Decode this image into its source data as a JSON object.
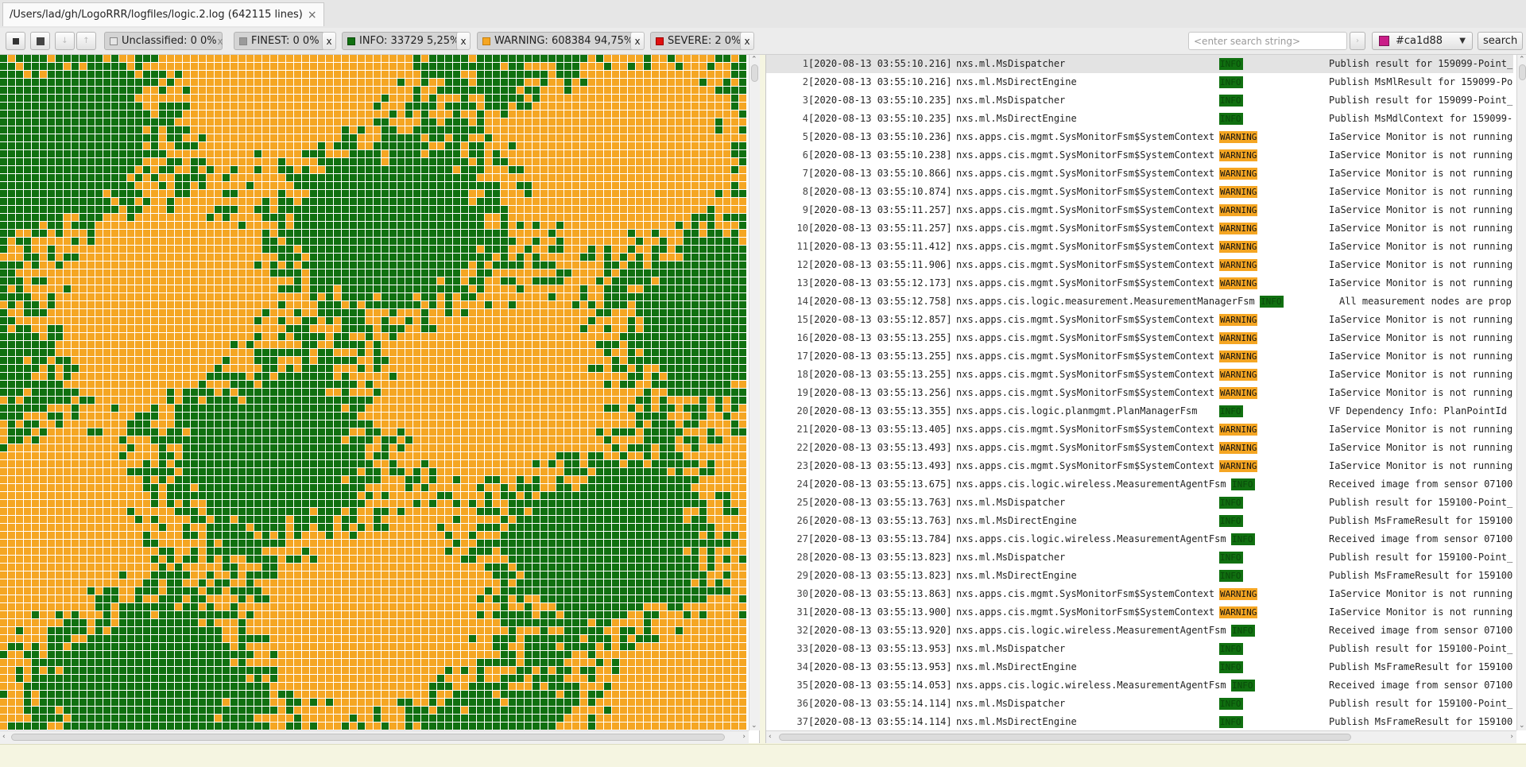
{
  "tab": {
    "title": "/Users/lad/gh/LogoRRR/logfiles/logic.2.log (642115 lines)",
    "close": "×"
  },
  "toolbar": {
    "filters": [
      {
        "label": "Unclassified: 0 0%",
        "color": "#e6e6e6"
      },
      {
        "label": "FINEST: 0 0%",
        "color": "#9a9a9a"
      },
      {
        "label": "INFO: 33729 5,25%",
        "color": "#107010"
      },
      {
        "label": "WARNING: 608384 94,75%",
        "color": "#f5a623"
      },
      {
        "label": "SEVERE: 2 0%",
        "color": "#e01010"
      }
    ],
    "remove": "x",
    "search_placeholder": "<enter search string>",
    "color_value": "#ca1d88",
    "search_button": "search"
  },
  "grid": {
    "info_color": "#107010",
    "warning_color": "#f5a623"
  },
  "log": {
    "rows": [
      {
        "n": "1",
        "ts": "[2020-08-13 03:55:10.216]",
        "logger": "nxs.ml.MsDispatcher",
        "level": "INFO",
        "msg": "Publish result for 159099-Point_"
      },
      {
        "n": "2",
        "ts": "[2020-08-13 03:55:10.216]",
        "logger": "nxs.ml.MsDirectEngine",
        "level": "INFO",
        "msg": "Publish MsMlResult for 159099-Po"
      },
      {
        "n": "3",
        "ts": "[2020-08-13 03:55:10.235]",
        "logger": "nxs.ml.MsDispatcher",
        "level": "INFO",
        "msg": "Publish result for 159099-Point_"
      },
      {
        "n": "4",
        "ts": "[2020-08-13 03:55:10.235]",
        "logger": "nxs.ml.MsDirectEngine",
        "level": "INFO",
        "msg": "Publish MsMdlContext for 159099-"
      },
      {
        "n": "5",
        "ts": "[2020-08-13 03:55:10.236]",
        "logger": "nxs.apps.cis.mgmt.SysMonitorFsm$SystemContext",
        "level": "WARNING",
        "msg": "IaService Monitor is not running"
      },
      {
        "n": "6",
        "ts": "[2020-08-13 03:55:10.238]",
        "logger": "nxs.apps.cis.mgmt.SysMonitorFsm$SystemContext",
        "level": "WARNING",
        "msg": "IaService Monitor is not running"
      },
      {
        "n": "7",
        "ts": "[2020-08-13 03:55:10.866]",
        "logger": "nxs.apps.cis.mgmt.SysMonitorFsm$SystemContext",
        "level": "WARNING",
        "msg": "IaService Monitor is not running"
      },
      {
        "n": "8",
        "ts": "[2020-08-13 03:55:10.874]",
        "logger": "nxs.apps.cis.mgmt.SysMonitorFsm$SystemContext",
        "level": "WARNING",
        "msg": "IaService Monitor is not running"
      },
      {
        "n": "9",
        "ts": "[2020-08-13 03:55:11.257]",
        "logger": "nxs.apps.cis.mgmt.SysMonitorFsm$SystemContext",
        "level": "WARNING",
        "msg": "IaService Monitor is not running"
      },
      {
        "n": "10",
        "ts": "[2020-08-13 03:55:11.257]",
        "logger": "nxs.apps.cis.mgmt.SysMonitorFsm$SystemContext",
        "level": "WARNING",
        "msg": "IaService Monitor is not running"
      },
      {
        "n": "11",
        "ts": "[2020-08-13 03:55:11.412]",
        "logger": "nxs.apps.cis.mgmt.SysMonitorFsm$SystemContext",
        "level": "WARNING",
        "msg": "IaService Monitor is not running"
      },
      {
        "n": "12",
        "ts": "[2020-08-13 03:55:11.906]",
        "logger": "nxs.apps.cis.mgmt.SysMonitorFsm$SystemContext",
        "level": "WARNING",
        "msg": "IaService Monitor is not running"
      },
      {
        "n": "13",
        "ts": "[2020-08-13 03:55:12.173]",
        "logger": "nxs.apps.cis.mgmt.SysMonitorFsm$SystemContext",
        "level": "WARNING",
        "msg": "IaService Monitor is not running"
      },
      {
        "n": "14",
        "ts": "[2020-08-13 03:55:12.758]",
        "logger": "nxs.apps.cis.logic.measurement.MeasurementManagerFsm",
        "level": "INFO",
        "msg": "All measurement nodes are prop"
      },
      {
        "n": "15",
        "ts": "[2020-08-13 03:55:12.857]",
        "logger": "nxs.apps.cis.mgmt.SysMonitorFsm$SystemContext",
        "level": "WARNING",
        "msg": "IaService Monitor is not running"
      },
      {
        "n": "16",
        "ts": "[2020-08-13 03:55:13.255]",
        "logger": "nxs.apps.cis.mgmt.SysMonitorFsm$SystemContext",
        "level": "WARNING",
        "msg": "IaService Monitor is not running"
      },
      {
        "n": "17",
        "ts": "[2020-08-13 03:55:13.255]",
        "logger": "nxs.apps.cis.mgmt.SysMonitorFsm$SystemContext",
        "level": "WARNING",
        "msg": "IaService Monitor is not running"
      },
      {
        "n": "18",
        "ts": "[2020-08-13 03:55:13.255]",
        "logger": "nxs.apps.cis.mgmt.SysMonitorFsm$SystemContext",
        "level": "WARNING",
        "msg": "IaService Monitor is not running"
      },
      {
        "n": "19",
        "ts": "[2020-08-13 03:55:13.256]",
        "logger": "nxs.apps.cis.mgmt.SysMonitorFsm$SystemContext",
        "level": "WARNING",
        "msg": "IaService Monitor is not running"
      },
      {
        "n": "20",
        "ts": "[2020-08-13 03:55:13.355]",
        "logger": "nxs.apps.cis.logic.planmgmt.PlanManagerFsm",
        "level": "INFO",
        "msg": "VF Dependency Info: PlanPointId"
      },
      {
        "n": "21",
        "ts": "[2020-08-13 03:55:13.405]",
        "logger": "nxs.apps.cis.mgmt.SysMonitorFsm$SystemContext",
        "level": "WARNING",
        "msg": "IaService Monitor is not running"
      },
      {
        "n": "22",
        "ts": "[2020-08-13 03:55:13.493]",
        "logger": "nxs.apps.cis.mgmt.SysMonitorFsm$SystemContext",
        "level": "WARNING",
        "msg": "IaService Monitor is not running"
      },
      {
        "n": "23",
        "ts": "[2020-08-13 03:55:13.493]",
        "logger": "nxs.apps.cis.mgmt.SysMonitorFsm$SystemContext",
        "level": "WARNING",
        "msg": "IaService Monitor is not running"
      },
      {
        "n": "24",
        "ts": "[2020-08-13 03:55:13.675]",
        "logger": "nxs.apps.cis.logic.wireless.MeasurementAgentFsm",
        "level": "INFO",
        "msg": "Received image from sensor 07100"
      },
      {
        "n": "25",
        "ts": "[2020-08-13 03:55:13.763]",
        "logger": "nxs.ml.MsDispatcher",
        "level": "INFO",
        "msg": "Publish result for 159100-Point_"
      },
      {
        "n": "26",
        "ts": "[2020-08-13 03:55:13.763]",
        "logger": "nxs.ml.MsDirectEngine",
        "level": "INFO",
        "msg": "Publish MsFrameResult for 159100"
      },
      {
        "n": "27",
        "ts": "[2020-08-13 03:55:13.784]",
        "logger": "nxs.apps.cis.logic.wireless.MeasurementAgentFsm",
        "level": "INFO",
        "msg": "Received image from sensor 07100"
      },
      {
        "n": "28",
        "ts": "[2020-08-13 03:55:13.823]",
        "logger": "nxs.ml.MsDispatcher",
        "level": "INFO",
        "msg": "Publish result for 159100-Point_"
      },
      {
        "n": "29",
        "ts": "[2020-08-13 03:55:13.823]",
        "logger": "nxs.ml.MsDirectEngine",
        "level": "INFO",
        "msg": "Publish MsFrameResult for 159100"
      },
      {
        "n": "30",
        "ts": "[2020-08-13 03:55:13.863]",
        "logger": "nxs.apps.cis.mgmt.SysMonitorFsm$SystemContext",
        "level": "WARNING",
        "msg": "IaService Monitor is not running"
      },
      {
        "n": "31",
        "ts": "[2020-08-13 03:55:13.900]",
        "logger": "nxs.apps.cis.mgmt.SysMonitorFsm$SystemContext",
        "level": "WARNING",
        "msg": "IaService Monitor is not running"
      },
      {
        "n": "32",
        "ts": "[2020-08-13 03:55:13.920]",
        "logger": "nxs.apps.cis.logic.wireless.MeasurementAgentFsm",
        "level": "INFO",
        "msg": "Received image from sensor 07100"
      },
      {
        "n": "33",
        "ts": "[2020-08-13 03:55:13.953]",
        "logger": "nxs.ml.MsDispatcher",
        "level": "INFO",
        "msg": "Publish result for 159100-Point_"
      },
      {
        "n": "34",
        "ts": "[2020-08-13 03:55:13.953]",
        "logger": "nxs.ml.MsDirectEngine",
        "level": "INFO",
        "msg": "Publish MsFrameResult for 159100"
      },
      {
        "n": "35",
        "ts": "[2020-08-13 03:55:14.053]",
        "logger": "nxs.apps.cis.logic.wireless.MeasurementAgentFsm",
        "level": "INFO",
        "msg": "Received image from sensor 07100"
      },
      {
        "n": "36",
        "ts": "[2020-08-13 03:55:14.114]",
        "logger": "nxs.ml.MsDispatcher",
        "level": "INFO",
        "msg": "Publish result for 159100-Point_"
      },
      {
        "n": "37",
        "ts": "[2020-08-13 03:55:14.114]",
        "logger": "nxs.ml.MsDirectEngine",
        "level": "INFO",
        "msg": "Publish MsFrameResult for 159100"
      }
    ]
  }
}
